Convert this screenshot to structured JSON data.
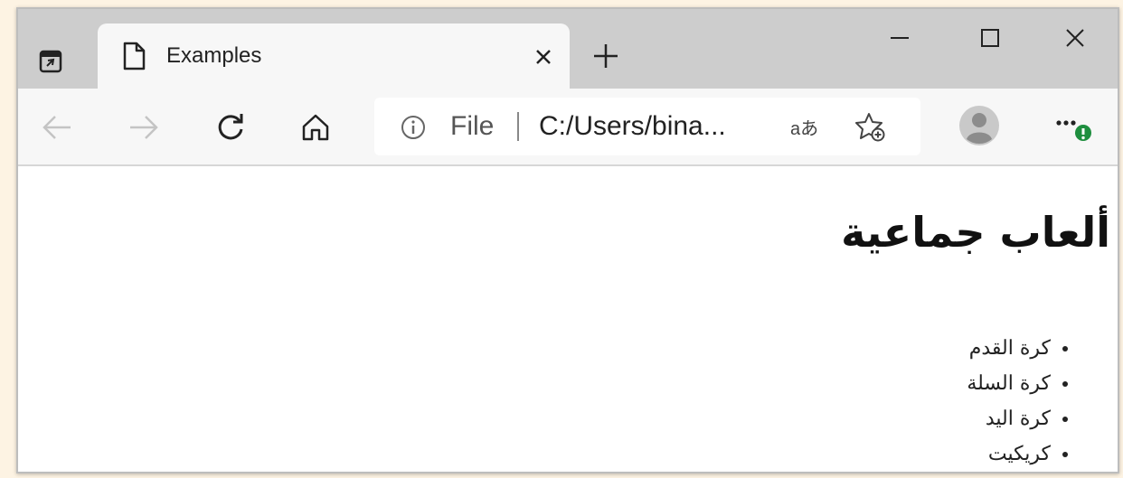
{
  "browser": {
    "tab": {
      "title": "Examples"
    },
    "address_bar": {
      "scheme_label": "File",
      "url": "C:/Users/bina...",
      "read_aloud_label": "aあ"
    },
    "new_tab_label": "+",
    "accent_color": "#1e8e3e",
    "icons": [
      "tab-actions-icon",
      "page-icon",
      "close-icon",
      "plus-icon",
      "minimize-icon",
      "maximize-icon",
      "close-window-icon",
      "back-arrow-icon",
      "forward-arrow-icon",
      "refresh-icon",
      "home-icon",
      "info-icon",
      "favorites-add-icon",
      "profile-avatar-icon",
      "more-options-icon"
    ]
  },
  "page": {
    "heading": "ألعاب جماعية",
    "games": [
      "كرة القدم",
      "كرة السلة",
      "كرة اليد",
      "كريكيت"
    ]
  }
}
